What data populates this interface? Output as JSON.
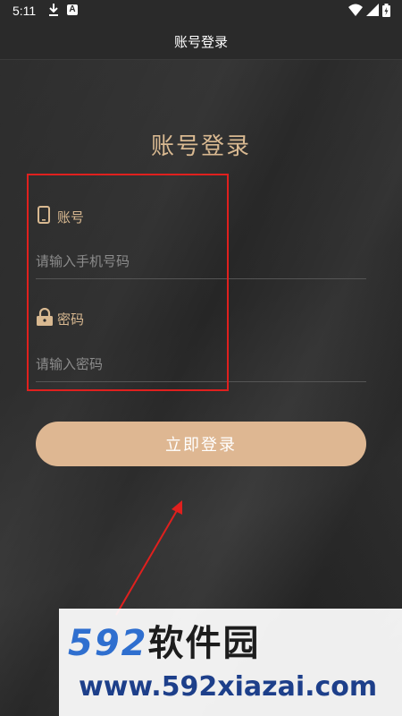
{
  "status_bar": {
    "time": "5:11",
    "icons": [
      "download-icon",
      "a-app-icon",
      "wifi-icon",
      "signal-icon",
      "battery-icon"
    ]
  },
  "app_bar": {
    "title": "账号登录"
  },
  "form": {
    "heading": "账号登录",
    "account": {
      "label": "账号",
      "icon": "phone-icon",
      "placeholder": "请输入手机号码",
      "value": ""
    },
    "password": {
      "label": "密码",
      "icon": "lock-icon",
      "placeholder": "请输入密码",
      "value": ""
    },
    "submit_label": "立即登录"
  },
  "annotation": {
    "box_color": "#e0201e",
    "arrow_color": "#e0201e"
  },
  "watermark": {
    "logo_number": "592",
    "logo_text": "软件园",
    "url": "www.592xiazai.com"
  },
  "colors": {
    "accent": "#d9b991",
    "button": "#deb792",
    "background": "#2b2b2b"
  }
}
